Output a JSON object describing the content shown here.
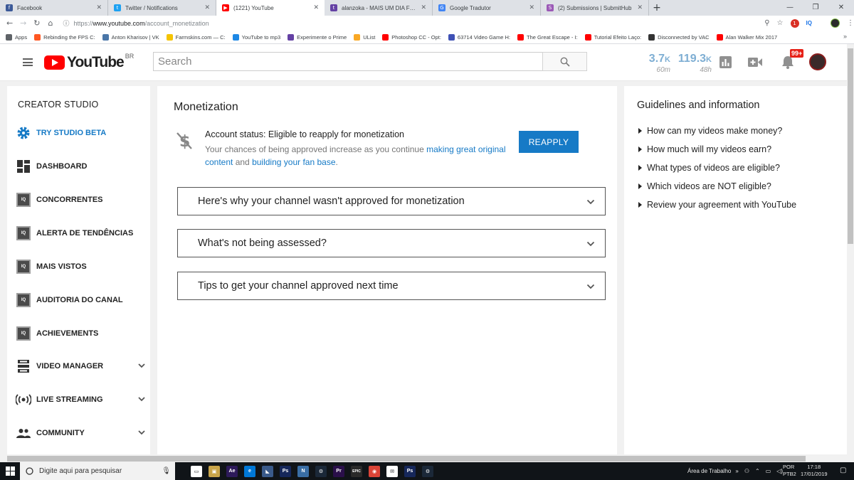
{
  "browser": {
    "tabs": [
      {
        "title": "Facebook",
        "color": "#3b5998",
        "glyph": "f"
      },
      {
        "title": "Twitter / Notifications",
        "color": "#1da1f2",
        "glyph": "t"
      },
      {
        "title": "(1221) YouTube",
        "color": "#ff0000",
        "glyph": "▶"
      },
      {
        "title": "alanzoka - MAIS UM DIA FORA D",
        "color": "#6441a4",
        "glyph": "t"
      },
      {
        "title": "Google Tradutor",
        "color": "#4285f4",
        "glyph": "G"
      },
      {
        "title": "(2) Submissions | SubmitHub",
        "color": "#9b59b6",
        "glyph": "S"
      }
    ],
    "active_tab": 2,
    "new_tab": "+",
    "url_scheme": "https://",
    "url_host": "www.youtube.com",
    "url_path": "/account_monetization",
    "ext_badge": "1",
    "ext_iq": "IQ",
    "bookmarks": [
      {
        "label": "Apps",
        "color": "#5f6368"
      },
      {
        "label": "Rebinding the FPS C:",
        "color": "#ff5722"
      },
      {
        "label": "Anton Kharisov | VK",
        "color": "#4a76a8"
      },
      {
        "label": "Farmskins.com — C:",
        "color": "#f5c400"
      },
      {
        "label": "YouTube to mp3",
        "color": "#1e88e5"
      },
      {
        "label": "Experimente o Prime",
        "color": "#6441a4"
      },
      {
        "label": "UList",
        "color": "#f9a825"
      },
      {
        "label": "Photoshop CC - Opt:",
        "color": "#ff0000"
      },
      {
        "label": "63714 Video Game H:",
        "color": "#3f51b5"
      },
      {
        "label": "The Great Escape - I:",
        "color": "#ff0000"
      },
      {
        "label": "Tutorial Efeito Laço:",
        "color": "#ff0000"
      },
      {
        "label": "Disconnected by VAC",
        "color": "#333333"
      },
      {
        "label": "Alan Walker Mix 2017",
        "color": "#ff0000"
      }
    ],
    "bookmarks_more": "»"
  },
  "youtube": {
    "country": "BR",
    "search_placeholder": "Search",
    "stats": [
      {
        "value": "3.7",
        "unit": "K",
        "period": "60m"
      },
      {
        "value": "119.3",
        "unit": "K",
        "period": "48h"
      }
    ],
    "notif_badge": "99+",
    "logo_word": "YouTube"
  },
  "sidebar": {
    "title": "CREATOR STUDIO",
    "items": [
      {
        "label": "TRY STUDIO BETA",
        "icon": "gear-icon",
        "highlight": true
      },
      {
        "label": "DASHBOARD",
        "icon": "dashboard-icon"
      },
      {
        "label": "CONCORRENTES",
        "icon": "iq-icon"
      },
      {
        "label": "ALERTA DE TENDÊNCIAS",
        "icon": "iq-icon"
      },
      {
        "label": "MAIS VISTOS",
        "icon": "iq-icon"
      },
      {
        "label": "AUDITORIA DO CANAL",
        "icon": "iq-icon"
      },
      {
        "label": "ACHIEVEMENTS",
        "icon": "iq-icon"
      },
      {
        "label": "VIDEO MANAGER",
        "icon": "video-manager-icon",
        "expandable": true
      },
      {
        "label": "LIVE STREAMING",
        "icon": "live-icon",
        "expandable": true
      },
      {
        "label": "COMMUNITY",
        "icon": "community-icon",
        "expandable": true
      }
    ],
    "iq_glyph": "IQ"
  },
  "main": {
    "title": "Monetization",
    "account_status": "Account status: Eligible to reapply for monetization",
    "desc_before": "Your chances of being approved increase as you continue ",
    "desc_link1": "making great original content",
    "desc_middle": " and ",
    "desc_link2": "building your fan base",
    "desc_after": ".",
    "reapply_label": "REAPPLY",
    "accordions": [
      "Here's why your channel wasn't approved for monetization",
      "What's not being assessed?",
      "Tips to get your channel approved next time"
    ]
  },
  "guidelines": {
    "title": "Guidelines and information",
    "items": [
      "How can my videos make money?",
      "How much will my videos earn?",
      "What types of videos are eligible?",
      "Which videos are NOT eligible?",
      "Review your agreement with YouTube"
    ]
  },
  "taskbar": {
    "search_placeholder": "Digite aqui para pesquisar",
    "desktop_label": "Área de Trabalho",
    "desktop_more": "»",
    "lang_top": "POR",
    "lang_bottom": "PTB2",
    "time": "17:18",
    "date": "17/01/2019",
    "apps": [
      {
        "name": "task-view",
        "color": "#ffffff",
        "glyph": "▭"
      },
      {
        "name": "store",
        "color": "#c9a54a",
        "glyph": "▣"
      },
      {
        "name": "after-effects",
        "color": "#2d1a5a",
        "glyph": "Ae"
      },
      {
        "name": "edge",
        "color": "#0078d7",
        "glyph": "e"
      },
      {
        "name": "sublime",
        "color": "#3a5a8a",
        "glyph": "◣"
      },
      {
        "name": "photoshop",
        "color": "#16275a",
        "glyph": "Ps"
      },
      {
        "name": "app-n",
        "color": "#3a6ea5",
        "glyph": "N"
      },
      {
        "name": "steam",
        "color": "#1b2838",
        "glyph": "⚙"
      },
      {
        "name": "premiere",
        "color": "#2a0f4a",
        "glyph": "Pr"
      },
      {
        "name": "epic",
        "color": "#2a2a2a",
        "glyph": "EPIC"
      },
      {
        "name": "chrome",
        "color": "#db4437",
        "glyph": "◉"
      },
      {
        "name": "mail",
        "color": "#ffffff",
        "glyph": "✉"
      },
      {
        "name": "photoshop-2",
        "color": "#16275a",
        "glyph": "Ps"
      },
      {
        "name": "steam-2",
        "color": "#1b2838",
        "glyph": "⚙"
      }
    ]
  }
}
